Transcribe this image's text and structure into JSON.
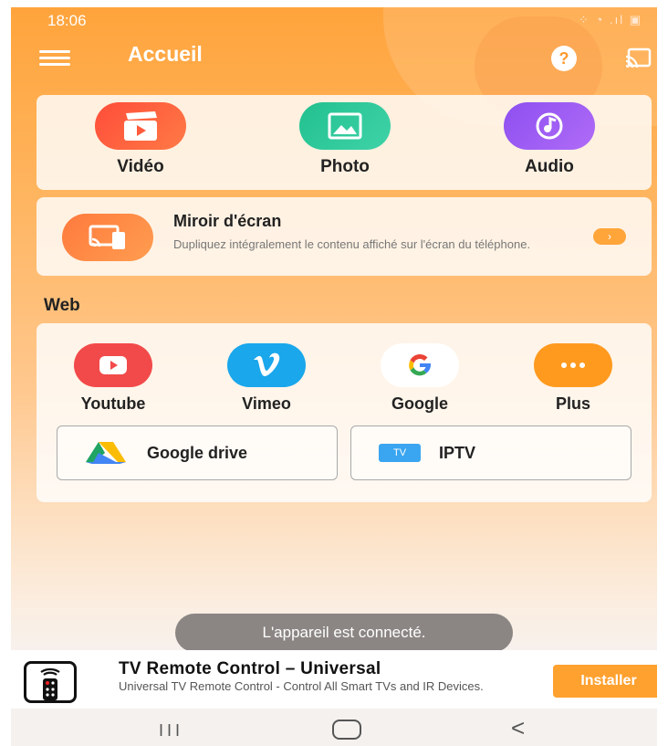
{
  "status_bar": {
    "time": "18:06",
    "icons": "⁘ ◔ .ıl ▣"
  },
  "app_bar": {
    "title": "Accueil",
    "help_glyph": "?"
  },
  "media": [
    {
      "label": "Vidéo",
      "icon": "video-clapper-icon",
      "color": "#ff5a3c"
    },
    {
      "label": "Photo",
      "icon": "photo-icon",
      "color": "#2fc79a"
    },
    {
      "label": "Audio",
      "icon": "music-note-icon",
      "color": "#9b5cf0"
    }
  ],
  "mirror": {
    "title": "Miroir d'écran",
    "description": "Dupliquez intégralement le contenu affiché sur l'écran du téléphone.",
    "arrow": "›"
  },
  "web": {
    "heading": "Web",
    "items": [
      {
        "label": "Youtube",
        "icon": "youtube-icon",
        "color": "#f24a4a"
      },
      {
        "label": "Vimeo",
        "icon": "vimeo-icon",
        "color": "#1aa7ec"
      },
      {
        "label": "Google",
        "icon": "google-icon",
        "color": "#ffffff"
      },
      {
        "label": "Plus",
        "icon": "more-icon",
        "color": "#ff9a1f"
      }
    ],
    "google_drive": "Google drive",
    "iptv": "IPTV",
    "iptv_badge": "TV"
  },
  "toast": "L'appareil est connecté.",
  "ad": {
    "title": "TV Remote Control – Universal",
    "description": "Universal TV Remote Control - Control All Smart TVs and IR Devices.",
    "install_label": "Installer"
  },
  "nav": {
    "recent": "III",
    "back": "<"
  }
}
